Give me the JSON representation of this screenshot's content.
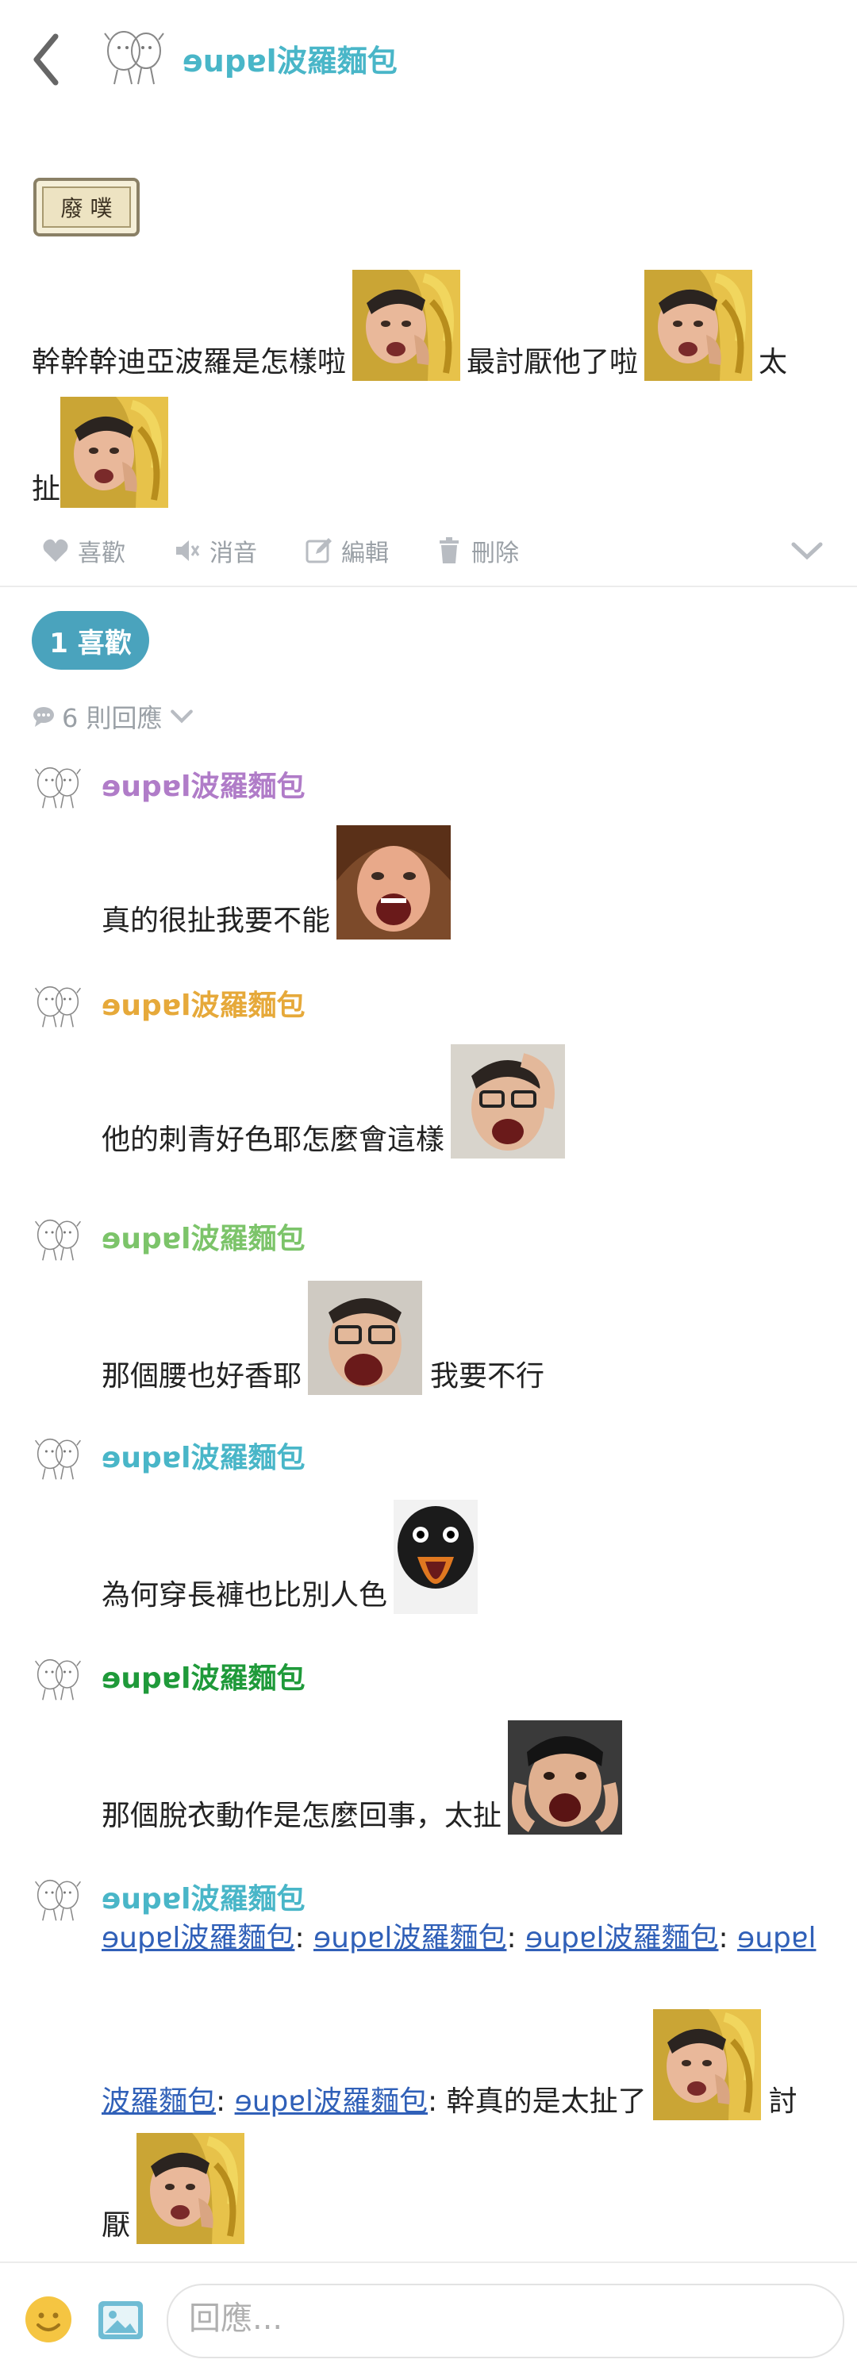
{
  "header": {
    "author": "ɘupɐl波羅麵包"
  },
  "sticker_text": "廢 噗",
  "post": {
    "seg1": "幹幹幹迪亞波羅是怎樣啦",
    "seg2": "最討厭他了啦",
    "seg3": "太",
    "seg4": "扯"
  },
  "actions": {
    "like": "喜歡",
    "mute": "消音",
    "edit": "編輯",
    "delete": "刪除"
  },
  "likes": {
    "label": "1 喜歡"
  },
  "replies": {
    "label": "6 則回應"
  },
  "comments": [
    {
      "name": "ɘupɐl波羅麵包",
      "color": "#b07cc8",
      "text": "真的很扯我要不能"
    },
    {
      "name": "ɘupɐl波羅麵包",
      "color": "#e6a93a",
      "text": "他的刺青好色耶怎麼會這樣"
    },
    {
      "name": "ɘupɐl波羅麵包",
      "color": "#7cc46a",
      "text": "那個腰也好香耶",
      "text2": "我要不行"
    },
    {
      "name": "ɘupɐl波羅麵包",
      "color": "#49b6c8",
      "text": "為何穿長褲也比別人色"
    },
    {
      "name": "ɘupɐl波羅麵包",
      "color": "#1f9a3a",
      "text": "那個脫衣動作是怎麼回事，太扯"
    },
    {
      "name": "ɘupɐl波羅麵包",
      "color": "#49b6c8",
      "mentions": [
        "ɘupɐl波羅麵包",
        "ɘupɐl波羅麵包",
        "ɘupɐl波羅麵包",
        "ɘupɐl",
        "波羅麵包",
        "ɘupɐl波羅麵包"
      ],
      "text": ": 幹真的是太扯了",
      "text2": "討",
      "text3": "厭"
    }
  ],
  "input": {
    "placeholder": "回應..."
  },
  "colors": {
    "accent": "#4aa3bd",
    "mention": "#3060b8",
    "header_name": "#49b6c8"
  }
}
